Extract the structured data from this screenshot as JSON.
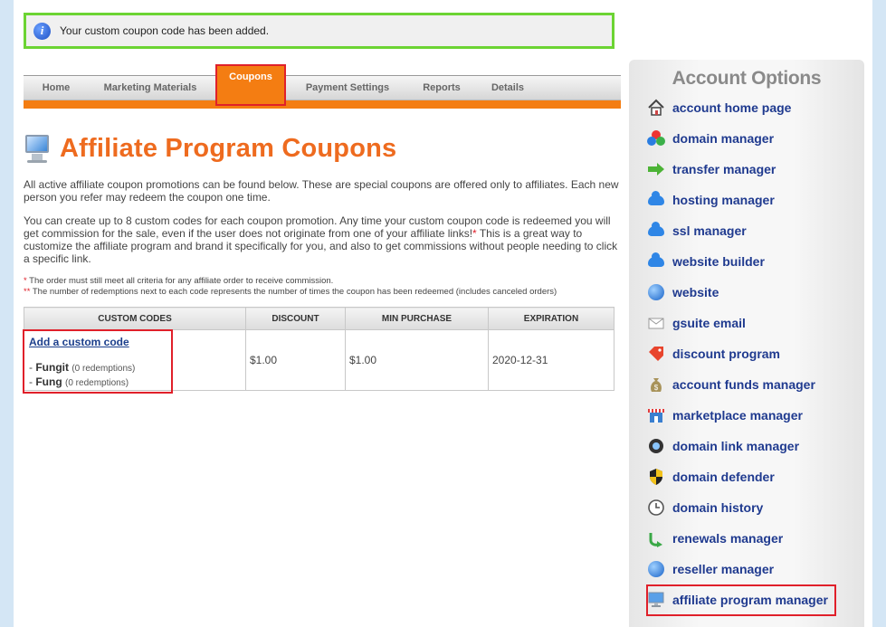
{
  "notice": {
    "text": "Your custom coupon code has been added."
  },
  "tabs": [
    {
      "label": "Home"
    },
    {
      "label": "Marketing Materials"
    },
    {
      "label": "Coupons"
    },
    {
      "label": "Payment Settings"
    },
    {
      "label": "Reports"
    },
    {
      "label": "Details"
    }
  ],
  "page_title": "Affiliate Program Coupons",
  "intro": {
    "p1": "All active affiliate coupon promotions can be found below. These are special coupons are offered only to affiliates. Each new person you refer may redeem the coupon one time.",
    "p2a": "You can create up to 8 custom codes for each coupon promotion. Any time your custom coupon code is redeemed you will get commission for the sale, even if the user does not originate from one of your affiliate links!",
    "p2star": "*",
    "p2b": " This is a great way to customize the affiliate program and brand it specifically for you, and also to get commissions without people needing to click a specific link."
  },
  "notes": {
    "n1_mark": "*",
    "n1": " The order must still meet all criteria for any affiliate order to receive commission.",
    "n2_mark": "**",
    "n2": " The number of redemptions next to each code represents the number of times the coupon has been redeemed (includes canceled orders)"
  },
  "table": {
    "headers": [
      "CUSTOM CODES",
      "DISCOUNT",
      "MIN PURCHASE",
      "EXPIRATION"
    ],
    "add_link": "Add a custom code",
    "codes": [
      {
        "prefix": "- ",
        "name": "Fungit",
        "redemptions": "(0 redemptions)"
      },
      {
        "prefix": "- ",
        "name": "Fung",
        "redemptions": "(0 redemptions)"
      }
    ],
    "discount": "$1.00",
    "min_purchase": "$1.00",
    "expiration": "2020-12-31"
  },
  "sidebar": {
    "title": "Account Options",
    "items": [
      {
        "label": "account home page",
        "icon": "house-icon"
      },
      {
        "label": "domain manager",
        "icon": "domain-balls-icon"
      },
      {
        "label": "transfer manager",
        "icon": "green-arrow-icon"
      },
      {
        "label": "hosting manager",
        "icon": "cloud-icon"
      },
      {
        "label": "ssl manager",
        "icon": "cloud-icon"
      },
      {
        "label": "website builder",
        "icon": "cloud-icon"
      },
      {
        "label": "website",
        "icon": "globe-icon"
      },
      {
        "label": "gsuite email",
        "icon": "envelope-icon"
      },
      {
        "label": "discount program",
        "icon": "tag-icon"
      },
      {
        "label": "account funds manager",
        "icon": "money-bag-icon"
      },
      {
        "label": "marketplace manager",
        "icon": "storefront-icon"
      },
      {
        "label": "domain link manager",
        "icon": "link-globe-icon"
      },
      {
        "label": "domain defender",
        "icon": "shield-icon"
      },
      {
        "label": "domain history",
        "icon": "clock-icon"
      },
      {
        "label": "renewals manager",
        "icon": "renew-arrow-icon"
      },
      {
        "label": "reseller manager",
        "icon": "globe-icon"
      },
      {
        "label": "affiliate program manager",
        "icon": "monitor-icon"
      }
    ]
  }
}
